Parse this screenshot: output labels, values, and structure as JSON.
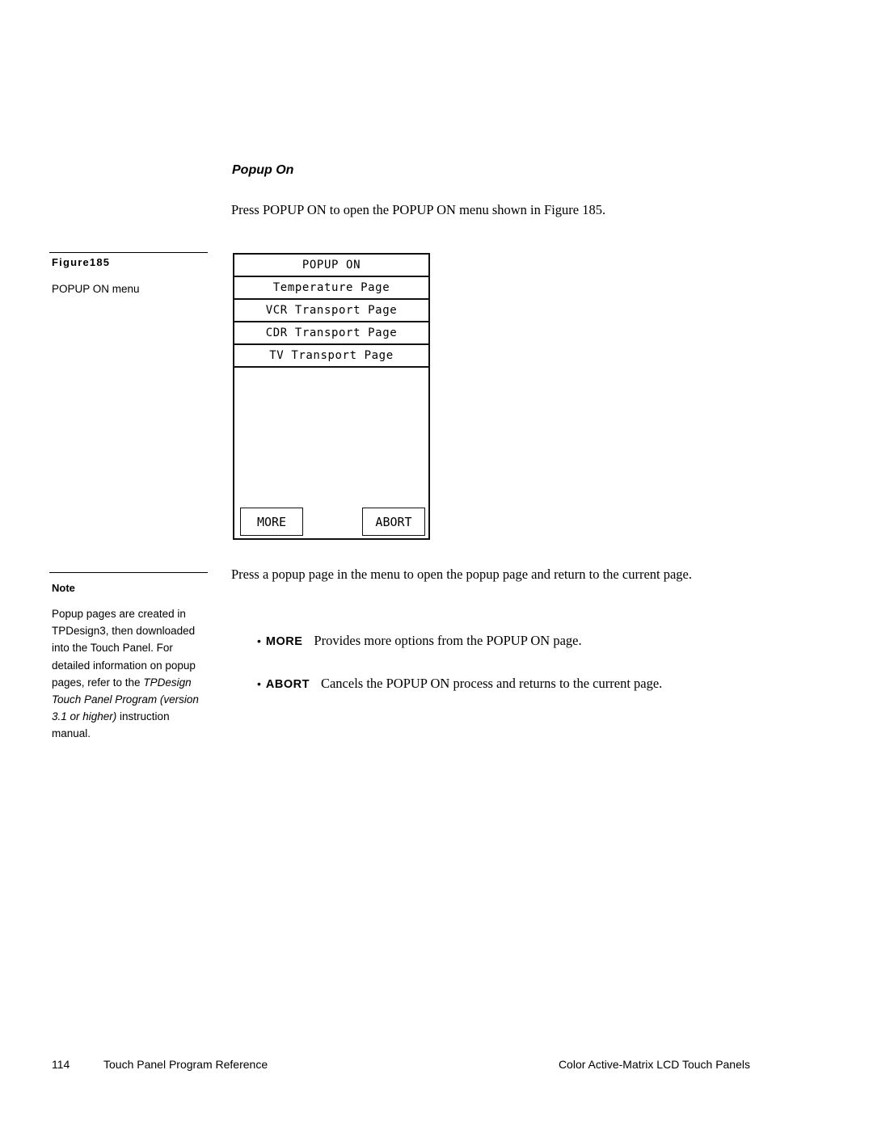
{
  "section": {
    "title": "Popup On",
    "intro": "Press POPUP ON to open the POPUP ON menu shown in Figure 185."
  },
  "figure": {
    "label": "Figure185",
    "caption": "POPUP ON menu"
  },
  "popup_menu": {
    "title": "POPUP ON",
    "items": [
      {
        "label": "Temperature Page"
      },
      {
        "label": "VCR Transport Page"
      },
      {
        "label": "CDR Transport Page"
      },
      {
        "label": "TV Transport Page"
      }
    ],
    "more_button": "MORE",
    "abort_button": "ABORT"
  },
  "body": {
    "paragraph": "Press a popup page in the menu to open the popup page and return to the current page.",
    "bullets": [
      {
        "term": "MORE",
        "text": "Provides more options from the POPUP ON page."
      },
      {
        "term": "ABORT",
        "text": "Cancels the POPUP ON process and returns to the current page."
      }
    ]
  },
  "note": {
    "heading": "Note",
    "text_part1": "Popup pages are created in TPDesign3, then downloaded into the Touch Panel. For detailed information on popup pages, refer to the ",
    "text_italic": "TPDesign Touch Panel Program (version 3.1 or higher)",
    "text_part2": " instruction manual."
  },
  "footer": {
    "page_number": "114",
    "left_title": "Touch Panel Program Reference",
    "right_title": "Color Active-Matrix LCD Touch Panels"
  }
}
